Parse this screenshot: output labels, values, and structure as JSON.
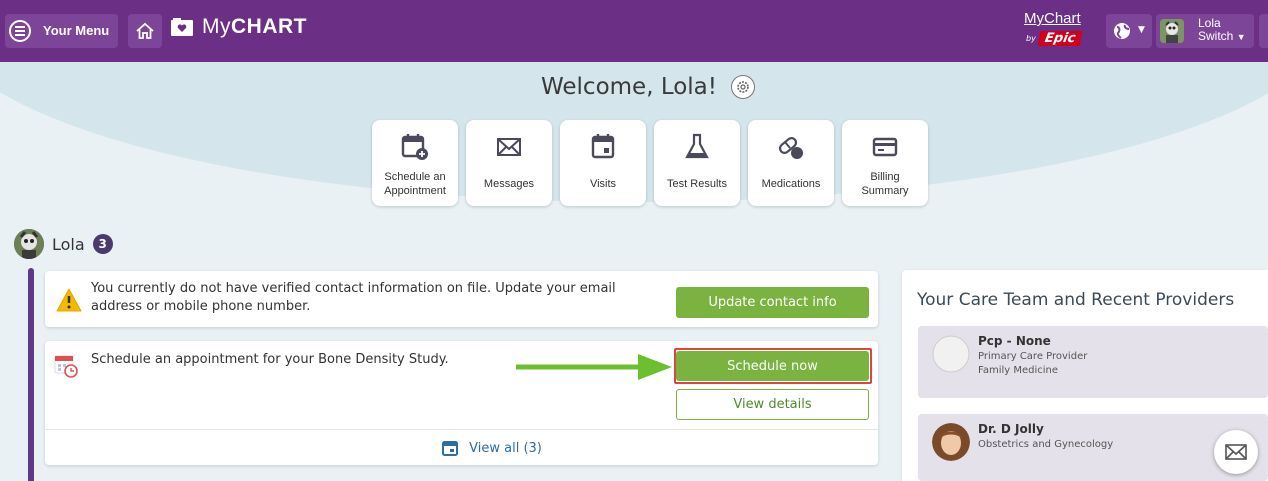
{
  "topbar": {
    "menu_label": "Your Menu",
    "logo_prefix": "My",
    "logo_bold": "CHART",
    "epic_line1": "MyChart",
    "epic_by": "by",
    "epic_word": "Epic",
    "user_first": "Lola",
    "user_switch": "Switch"
  },
  "welcome": {
    "title": "Welcome, Lola!"
  },
  "tiles": [
    {
      "icon": "calendar-plus-icon",
      "label": "Schedule an Appointment"
    },
    {
      "icon": "envelope-icon",
      "label": "Messages"
    },
    {
      "icon": "calendar-icon",
      "label": "Visits"
    },
    {
      "icon": "flask-icon",
      "label": "Test Results"
    },
    {
      "icon": "pills-icon",
      "label": "Medications"
    },
    {
      "icon": "credit-card-icon",
      "label": "Billing Summary"
    }
  ],
  "person": {
    "name": "Lola",
    "count": "3"
  },
  "alerts": {
    "contact_text": "You currently do not have verified contact information on file. Update your email address or mobile phone number.",
    "contact_button": "Update contact info",
    "schedule_text": "Schedule an appointment for your Bone Density Study.",
    "schedule_button": "Schedule now",
    "details_button": "View details",
    "view_all": "View all (3)"
  },
  "care_team": {
    "title": "Your Care Team and Recent Providers",
    "providers": [
      {
        "name": "Pcp - None",
        "role": "Primary Care Provider",
        "specialty": "Family Medicine"
      },
      {
        "name": "Dr. D Jolly",
        "role": "Obstetrics and Gynecology"
      }
    ]
  },
  "colors": {
    "topbar": "#6b2f86",
    "accent_green": "#7ab340",
    "highlight_red": "#e0443e",
    "badge": "#4b3970"
  }
}
